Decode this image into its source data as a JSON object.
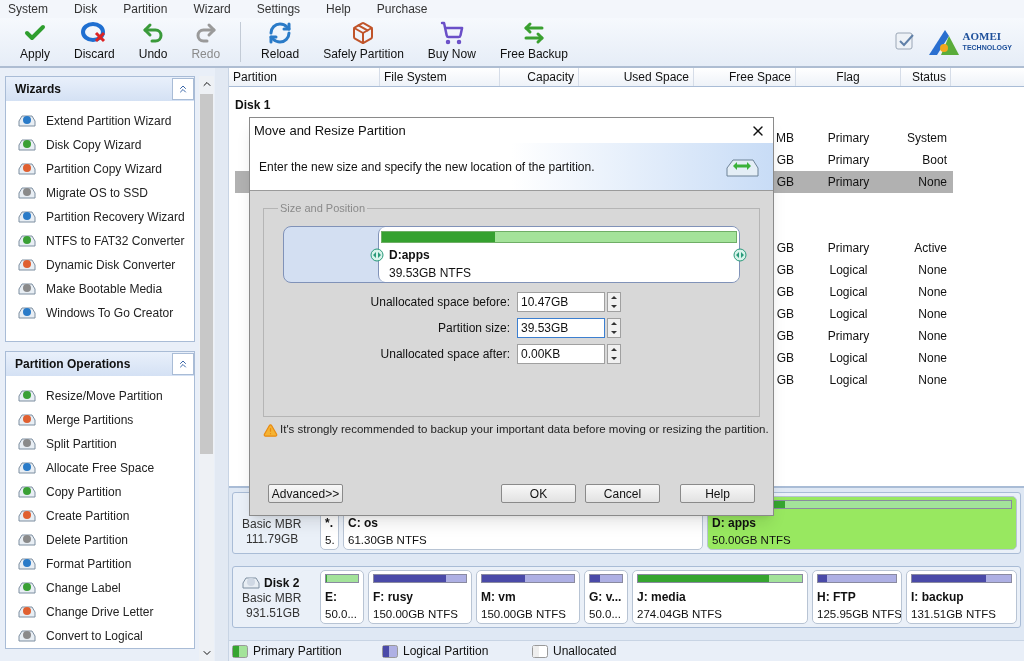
{
  "menu": [
    "System",
    "Disk",
    "Partition",
    "Wizard",
    "Settings",
    "Help",
    "Purchase"
  ],
  "toolbar": [
    {
      "label": "Apply",
      "kind": "apply",
      "disabled": false
    },
    {
      "label": "Discard",
      "kind": "discard",
      "disabled": false
    },
    {
      "label": "Undo",
      "kind": "undo",
      "disabled": false
    },
    {
      "label": "Redo",
      "kind": "redo",
      "disabled": true
    },
    {
      "label": "Reload",
      "kind": "reload",
      "disabled": false
    },
    {
      "label": "Safely Partition",
      "kind": "safely",
      "disabled": false
    },
    {
      "label": "Buy Now",
      "kind": "buy",
      "disabled": false
    },
    {
      "label": "Free Backup",
      "kind": "backup",
      "disabled": false
    }
  ],
  "logo": {
    "name": "AOMEI",
    "tagline": "TECHNOLOGY"
  },
  "sidebar": [
    {
      "title": "Wizards",
      "items": [
        "Extend Partition Wizard",
        "Disk Copy Wizard",
        "Partition Copy Wizard",
        "Migrate OS to SSD",
        "Partition Recovery Wizard",
        "NTFS to FAT32 Converter",
        "Dynamic Disk Converter",
        "Make Bootable Media",
        "Windows To Go Creator"
      ]
    },
    {
      "title": "Partition Operations",
      "items": [
        "Resize/Move Partition",
        "Merge Partitions",
        "Split Partition",
        "Allocate Free Space",
        "Copy Partition",
        "Create Partition",
        "Delete Partition",
        "Format Partition",
        "Change Label",
        "Change Drive Letter",
        "Convert to Logical"
      ]
    }
  ],
  "table": {
    "columns": [
      "Partition",
      "File System",
      "Capacity",
      "Used Space",
      "Free Space",
      "Flag",
      "Status"
    ],
    "disk_label": "Disk 1",
    "rows": [
      {
        "free_space": "MB",
        "flag": "Primary",
        "status": "System",
        "selected": false
      },
      {
        "free_space": "GB",
        "flag": "Primary",
        "status": "Boot",
        "selected": false
      },
      {
        "free_space": "GB",
        "flag": "Primary",
        "status": "None",
        "selected": true
      },
      {
        "gap": true,
        "free_space": "GB",
        "flag": "Primary",
        "status": "Active",
        "selected": false
      },
      {
        "free_space": "GB",
        "flag": "Logical",
        "status": "None",
        "selected": false
      },
      {
        "free_space": "GB",
        "flag": "Logical",
        "status": "None",
        "selected": false
      },
      {
        "free_space": "GB",
        "flag": "Logical",
        "status": "None",
        "selected": false
      },
      {
        "free_space": "GB",
        "flag": "Primary",
        "status": "None",
        "selected": false
      },
      {
        "free_space": "GB",
        "flag": "Logical",
        "status": "None",
        "selected": false
      },
      {
        "free_space": "GB",
        "flag": "Logical",
        "status": "None",
        "selected": false
      }
    ]
  },
  "disks": [
    {
      "type": "Basic MBR",
      "size": "111.79GB",
      "partitions": [
        {
          "name": "*.",
          "size": "5.",
          "kind": "primary",
          "selected": false
        },
        {
          "name": "C: os",
          "size": "61.30GB NTFS",
          "kind": "primary",
          "selected": false
        },
        {
          "name": "D: apps",
          "size": "50.00GB NTFS",
          "kind": "primary",
          "selected": true,
          "level": 0.24
        }
      ]
    },
    {
      "name": "Disk 2",
      "type": "Basic MBR",
      "size": "931.51GB",
      "partitions": [
        {
          "name": "E:",
          "size": "50.0...",
          "kind": "primary",
          "selected": false,
          "level": 0.02
        },
        {
          "name": "F: rusy",
          "size": "150.00GB NTFS",
          "kind": "logical",
          "selected": false,
          "level": 0.78
        },
        {
          "name": "M: vm",
          "size": "150.00GB NTFS",
          "kind": "logical",
          "selected": false,
          "level": 0.47
        },
        {
          "name": "G: v...",
          "size": "50.0...",
          "kind": "logical",
          "selected": false,
          "level": 0.3
        },
        {
          "name": "J: media",
          "size": "274.04GB NTFS",
          "kind": "primary",
          "selected": false,
          "level": 0.8
        },
        {
          "name": "H: FTP",
          "size": "125.95GB NTFS",
          "kind": "logical",
          "selected": false,
          "level": 0.12
        },
        {
          "name": "I: backup",
          "size": "131.51GB NTFS",
          "kind": "logical",
          "selected": false,
          "level": 0.75
        }
      ]
    }
  ],
  "legend": [
    {
      "label": "Primary Partition",
      "kind": "primary"
    },
    {
      "label": "Logical Partition",
      "kind": "logical"
    },
    {
      "label": "Unallocated",
      "kind": "unallocated"
    }
  ],
  "dialog": {
    "title": "Move and Resize Partition",
    "instruction": "Enter the new size and specify the new location of the partition.",
    "group": "Size and Position",
    "bar": {
      "name": "D:apps",
      "size": "39.53GB NTFS",
      "level": 0.32
    },
    "fields": [
      {
        "label": "Unallocated space before:",
        "value": "10.47GB",
        "focused": false
      },
      {
        "label": "Partition size:",
        "value": "39.53GB",
        "focused": true
      },
      {
        "label": "Unallocated space after:",
        "value": "0.00KB",
        "focused": false
      }
    ],
    "warning": "It's strongly recommended to backup your important data before moving or resizing the partition.",
    "buttons": [
      "Advanced>>",
      "OK",
      "Cancel",
      "Help"
    ]
  }
}
